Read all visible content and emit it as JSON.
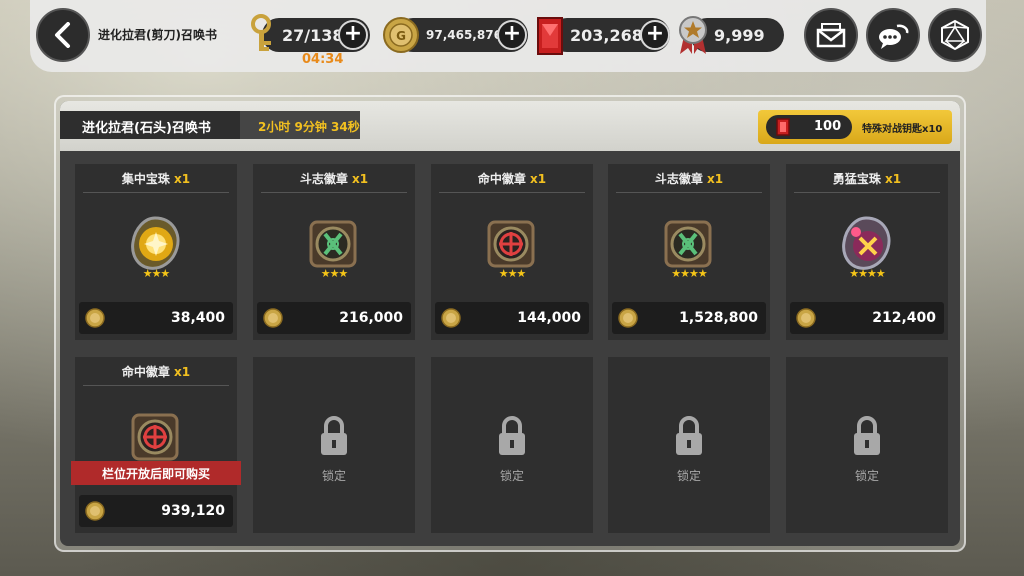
{
  "header": {
    "title": "进化拉君(剪刀)召唤书",
    "keys": {
      "value": "27/138",
      "timer": "04:34"
    },
    "gold": "97,465,876",
    "rubies": "203,268",
    "medals": "9,999"
  },
  "panel": {
    "title": "进化拉君(石头)召唤书",
    "countdown": "2小时 9分钟 34秒",
    "key_badge": {
      "count": "100",
      "label": "特殊对战钥匙x10"
    }
  },
  "items": [
    {
      "name": "集中宝珠",
      "qty": "x1",
      "stars": "★★★",
      "price": "38,400",
      "icon": "orb-gold-icon"
    },
    {
      "name": "斗志徽章",
      "qty": "x1",
      "stars": "★★★",
      "price": "216,000",
      "icon": "emblem-green-icon"
    },
    {
      "name": "命中徽章",
      "qty": "x1",
      "stars": "★★★",
      "price": "144,000",
      "icon": "emblem-red-icon"
    },
    {
      "name": "斗志徽章",
      "qty": "x1",
      "stars": "★★★★",
      "price": "1,528,800",
      "icon": "emblem-green-icon"
    },
    {
      "name": "勇猛宝珠",
      "qty": "x1",
      "stars": "★★★★",
      "price": "212,400",
      "icon": "orb-pink-icon"
    },
    {
      "name": "命中徽章",
      "qty": "x1",
      "price": "939,120",
      "icon": "emblem-red-icon",
      "locked_banner": "栏位开放后即可购买"
    }
  ],
  "locked_slots": [
    {
      "label": "锁定"
    },
    {
      "label": "锁定"
    },
    {
      "label": "锁定"
    },
    {
      "label": "锁定"
    }
  ],
  "colors": {
    "accent_gold": "#f2c020",
    "lock_banner": "#b02a2a",
    "timer_orange": "#e88a1a"
  }
}
